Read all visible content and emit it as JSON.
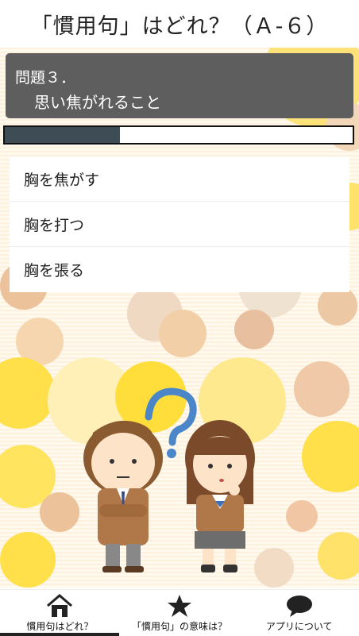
{
  "header": {
    "title": "「慣用句」はどれ？（Ａ-６）"
  },
  "question": {
    "number": "問題３．",
    "text": "思い焦がれること"
  },
  "progress": {
    "fraction": 0.33
  },
  "choices": [
    {
      "label": "胸を焦がす"
    },
    {
      "label": "胸を打つ"
    },
    {
      "label": "胸を張る"
    }
  ],
  "tabbar": {
    "tabs": [
      {
        "label": "慣用句はどれ？",
        "icon": "home-icon"
      },
      {
        "label": "「慣用句」の意味は？",
        "icon": "star-icon"
      },
      {
        "label": "アプリについて",
        "icon": "chat-bubble-icon"
      }
    ],
    "active_index": 0
  },
  "colors": {
    "accent_dark": "#3d4c55",
    "question_bg": "#5e5e5e",
    "dot_yellow": "#ffe04a",
    "dot_tan": "#e8c8a8"
  }
}
